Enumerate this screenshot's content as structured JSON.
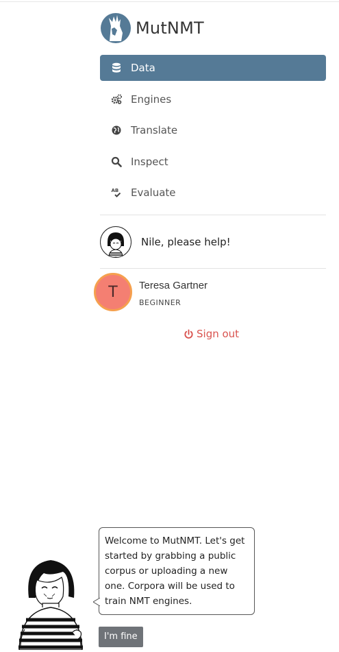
{
  "brand": {
    "name": "MutNMT"
  },
  "nav": {
    "items": [
      {
        "label": "Data",
        "icon": "database-icon",
        "active": true
      },
      {
        "label": "Engines",
        "icon": "gears-icon",
        "active": false
      },
      {
        "label": "Translate",
        "icon": "globe-icon",
        "active": false
      },
      {
        "label": "Inspect",
        "icon": "search-icon",
        "active": false
      },
      {
        "label": "Evaluate",
        "icon": "spell-check-icon",
        "active": false
      }
    ]
  },
  "help": {
    "label": "Nile, please help!"
  },
  "user": {
    "initial": "T",
    "name": "Teresa Gartner",
    "level": "BEGINNER"
  },
  "signout": {
    "label": "Sign out"
  },
  "tour": {
    "message": "Welcome to MutNMT. Let's get started by grabbing a public corpus or uploading a new one. Corpora will be used to train NMT engines.",
    "button_label": "I'm fine"
  },
  "colors": {
    "active_nav": "#557a96",
    "signout": "#d9534f",
    "avatar_bg": "#f47f72",
    "avatar_border": "#f5a04e"
  }
}
